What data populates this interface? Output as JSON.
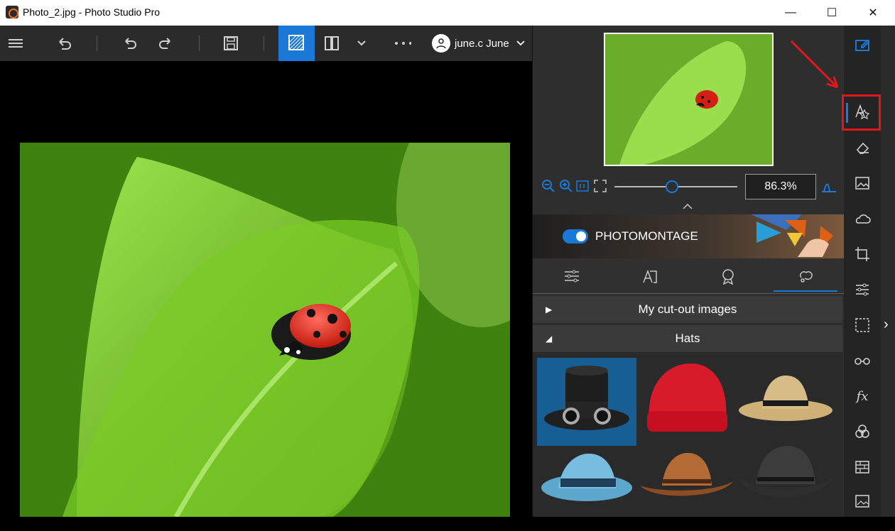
{
  "window": {
    "title": "Photo_2.jpg - Photo Studio Pro"
  },
  "toolbar": {
    "user_name": "june.c June"
  },
  "panel": {
    "zoom_value": "86.3%",
    "banner_label": "PHOTOMONTAGE",
    "groups": [
      {
        "label": "My cut-out images"
      },
      {
        "label": "Hats"
      }
    ],
    "hat_items": [
      {
        "name": "top-hat-goggles",
        "selected": true
      },
      {
        "name": "red-beanie",
        "selected": false
      },
      {
        "name": "straw-cowboy-hat",
        "selected": false
      },
      {
        "name": "blue-fedora",
        "selected": false
      },
      {
        "name": "brown-cowboy-hat",
        "selected": false
      },
      {
        "name": "black-cowboy-hat",
        "selected": false
      }
    ]
  },
  "sidebar": {
    "items": [
      "edit-icon",
      "text-icon",
      "eraser-icon",
      "image-icon",
      "weather-icon",
      "crop-icon",
      "sliders-icon",
      "selection-icon",
      "glasses-icon",
      "fx-icon",
      "color-circles-icon",
      "texture-icon",
      "photo-icon"
    ]
  },
  "colors": {
    "accent": "#1a78d6",
    "highlight": "#e3161b"
  }
}
